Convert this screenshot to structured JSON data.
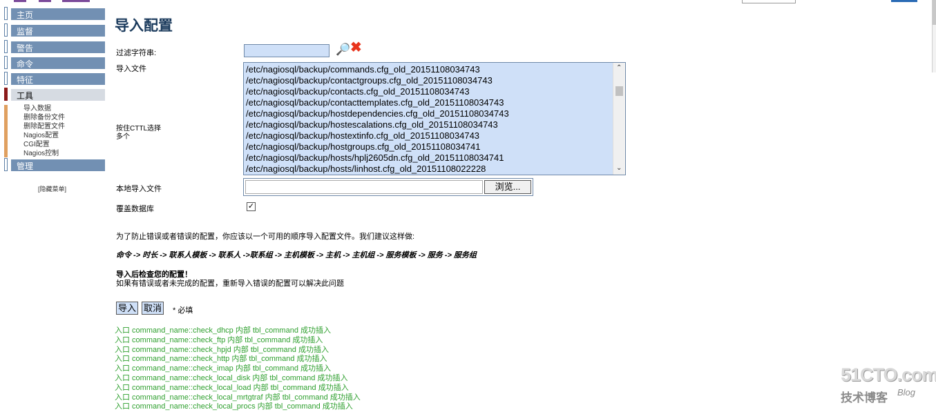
{
  "sidebar": {
    "items": [
      {
        "label": "主页"
      },
      {
        "label": "监督"
      },
      {
        "label": "警告"
      },
      {
        "label": "命令"
      },
      {
        "label": "特征"
      },
      {
        "label": "工具"
      },
      {
        "label": "管理"
      }
    ],
    "tools_subitems": [
      "导入数据",
      "删除备份文件",
      "删除配置文件",
      "Nagios配置",
      "CGI配置",
      "Nagios控制"
    ],
    "hide_menu": "[隐藏菜单]"
  },
  "page": {
    "title": "导入配置",
    "filter_label": "过滤字符串:",
    "import_file_label": "导入文件",
    "ctrl_hint_1": "按住CTTL选择",
    "ctrl_hint_2": "多个",
    "files": [
      "/etc/nagiosql/backup/commands.cfg_old_20151108034743",
      "/etc/nagiosql/backup/contactgroups.cfg_old_20151108034743",
      "/etc/nagiosql/backup/contacts.cfg_old_20151108034743",
      "/etc/nagiosql/backup/contacttemplates.cfg_old_20151108034743",
      "/etc/nagiosql/backup/hostdependencies.cfg_old_20151108034743",
      "/etc/nagiosql/backup/hostescalations.cfg_old_20151108034743",
      "/etc/nagiosql/backup/hostextinfo.cfg_old_20151108034743",
      "/etc/nagiosql/backup/hostgroups.cfg_old_20151108034741",
      "/etc/nagiosql/backup/hosts/hplj2605dn.cfg_old_20151108034741",
      "/etc/nagiosql/backup/hosts/linhost.cfg_old_20151108022228"
    ],
    "local_file_label": "本地导入文件",
    "browse_label": "浏览...",
    "overwrite_label": "覆盖数据库",
    "checkbox_mark": "✓",
    "note": "为了防止错误或者错误的配置，你应该以一个可用的顺序导入配置文件。我们建议这样做:",
    "order": "命令 -> 时长 -> 联系人模板 -> 联系人 ->联系组 -> 主机模板 -> 主机 -> 主机组 -> 服务模板 -> 服务 -> 服务组",
    "check_title": "导入后检查您的配置！",
    "check_text": "如果有错误或者未完成的配置，重新导入错误的配置可以解决此问题",
    "import_btn": "导入",
    "cancel_btn": "取消",
    "required": "* 必填",
    "log": [
      "入口 command_name::check_dhcp 内部 tbl_command 成功插入",
      "入口 command_name::check_ftp 内部 tbl_command 成功插入",
      "入口 command_name::check_hpjd 内部 tbl_command 成功插入",
      "入口 command_name::check_http 内部 tbl_command 成功插入",
      "入口 command_name::check_imap 内部 tbl_command 成功插入",
      "入口 command_name::check_local_disk 内部 tbl_command 成功插入",
      "入口 command_name::check_local_load 内部 tbl_command 成功插入",
      "入口 command_name::check_local_mrtgtraf 内部 tbl_command 成功插入",
      "入口 command_name::check_local_procs 内部 tbl_command 成功插入"
    ]
  },
  "watermark": {
    "big": "51CTO.com",
    "small": "技术博客",
    "blog": "Blog"
  }
}
